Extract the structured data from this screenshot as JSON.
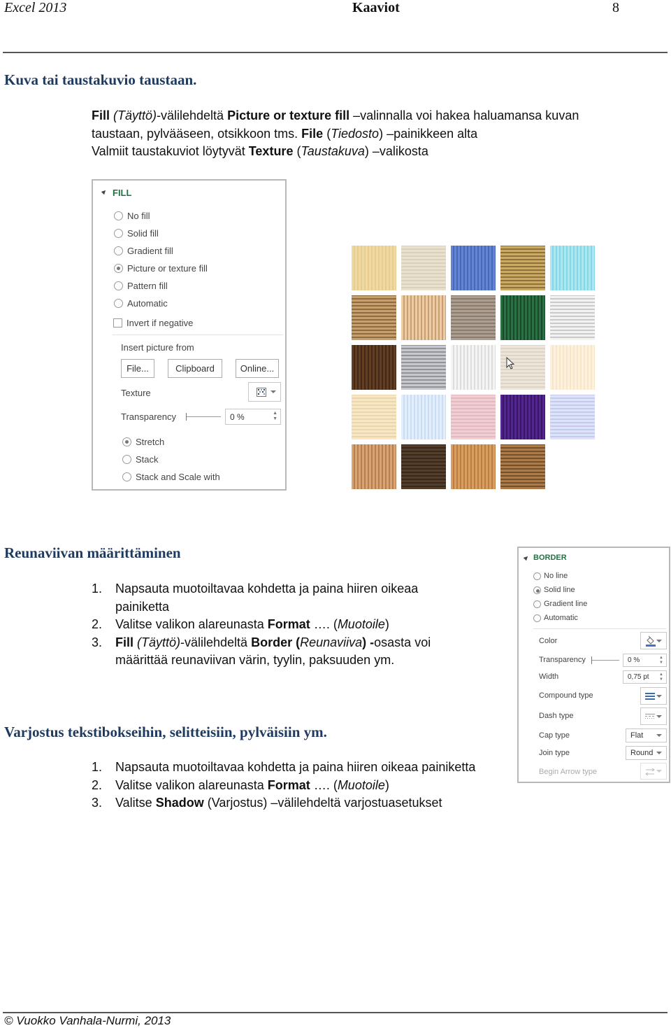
{
  "header": {
    "left": "Excel 2013",
    "center": "Kaaviot",
    "page_number": "8"
  },
  "section1": {
    "title": "Kuva tai taustakuvio taustaan.",
    "para_runs": [
      [
        {
          "t": "Fill",
          "b": true
        },
        {
          "t": " (Täyttö)",
          "i": true
        },
        {
          "t": "-välilehdeltä "
        },
        {
          "t": "Picture or texture fill",
          "b": true
        },
        {
          "t": "  –valinnalla voi hakea haluamansa kuvan"
        }
      ],
      [
        {
          "t": "taustaan,  pylvääseen, otsikkoon tms. "
        },
        {
          "t": "File",
          "b": true
        },
        {
          "t": " ("
        },
        {
          "t": "Tiedosto",
          "i": true
        },
        {
          "t": ")  –painikkeen alta"
        }
      ],
      [
        {
          "t": "Valmiit taustakuviot löytyvät "
        },
        {
          "t": "Texture",
          "b": true
        },
        {
          "t": " ("
        },
        {
          "t": "Taustakuva",
          "i": true
        },
        {
          "t": ") –valikosta"
        }
      ]
    ]
  },
  "fill_panel": {
    "title": "FILL",
    "options": [
      {
        "label": "No fill",
        "selected": false
      },
      {
        "label": "Solid fill",
        "selected": false
      },
      {
        "label": "Gradient fill",
        "selected": false
      },
      {
        "label": "Picture or texture fill",
        "selected": true
      },
      {
        "label": "Pattern fill",
        "selected": false
      },
      {
        "label": "Automatic",
        "selected": false
      }
    ],
    "invert_label": "Invert if negative",
    "invert_checked": false,
    "insert_from_label": "Insert picture from",
    "buttons": {
      "file": "File...",
      "clipboard": "Clipboard",
      "online": "Online..."
    },
    "texture_label": "Texture",
    "texture_icon": "texture-icon",
    "transparency_label": "Transparency",
    "transparency_value": "0 %",
    "transparency_percent": 0,
    "tiling": [
      {
        "label": "Stretch",
        "selected": true
      },
      {
        "label": "Stack",
        "selected": false
      },
      {
        "label": "Stack and Scale with",
        "selected": false
      }
    ]
  },
  "textures": [
    {
      "name": "papyrus",
      "colors": [
        "#f0d9a0",
        "#e6c98a"
      ]
    },
    {
      "name": "canvas",
      "colors": [
        "#e8e0cc",
        "#d8cfb8"
      ]
    },
    {
      "name": "denim",
      "colors": [
        "#5b7fd0",
        "#3f62b8"
      ]
    },
    {
      "name": "woven-mat",
      "colors": [
        "#c9a65c",
        "#8a6a32"
      ]
    },
    {
      "name": "water-droplets",
      "colors": [
        "#a8e6f0",
        "#7fd4e6"
      ]
    },
    {
      "name": "paper-bag",
      "colors": [
        "#c49a66",
        "#8a6438"
      ]
    },
    {
      "name": "fish-fossil",
      "colors": [
        "#edc9a0",
        "#c59a6b"
      ]
    },
    {
      "name": "sand",
      "colors": [
        "#a89a8c",
        "#857566"
      ]
    },
    {
      "name": "green-marble",
      "colors": [
        "#1f6b3a",
        "#0d3f20"
      ]
    },
    {
      "name": "white-marble",
      "colors": [
        "#f2f2f2",
        "#c8c8c8"
      ]
    },
    {
      "name": "brown-marble",
      "colors": [
        "#5a3418",
        "#3a1e0c"
      ]
    },
    {
      "name": "granite",
      "colors": [
        "#c4c6cc",
        "#8c8e94"
      ]
    },
    {
      "name": "newsprint",
      "colors": [
        "#f4f4f4",
        "#dcdcdc"
      ]
    },
    {
      "name": "recycled-paper",
      "colors": [
        "#ece4d8",
        "#dcd2c2"
      ]
    },
    {
      "name": "parchment",
      "colors": [
        "#fdf1dc",
        "#f6e6c8"
      ]
    },
    {
      "name": "stationery",
      "colors": [
        "#f6e6c4",
        "#ead4a8"
      ]
    },
    {
      "name": "blue-tissue-paper",
      "colors": [
        "#e2eefc",
        "#c8dcf4"
      ]
    },
    {
      "name": "pink-tissue-paper",
      "colors": [
        "#f0cdd2",
        "#e4b4bc"
      ]
    },
    {
      "name": "purple-mesh",
      "colors": [
        "#4a1a8a",
        "#2e0c5e"
      ]
    },
    {
      "name": "bouquet",
      "colors": [
        "#d8e4f8",
        "#c8c4ec"
      ]
    },
    {
      "name": "cork",
      "colors": [
        "#d8a06a",
        "#b07a48"
      ]
    },
    {
      "name": "walnut",
      "colors": [
        "#4a3420",
        "#2e1e10"
      ]
    },
    {
      "name": "oak",
      "colors": [
        "#d69a58",
        "#b87838"
      ]
    },
    {
      "name": "medium-wood",
      "colors": [
        "#a87440",
        "#6e4820"
      ]
    }
  ],
  "section2": {
    "title": "Reunaviivan määrittäminen",
    "items": [
      {
        "num": "1.",
        "runs": [
          {
            "t": "Napsauta muotoiltavaa kohdetta ja paina hiiren oikeaa painiketta"
          }
        ]
      },
      {
        "num": "2.",
        "runs": [
          {
            "t": "Valitse valikon alareunasta  "
          },
          {
            "t": "Format",
            "b": true
          },
          {
            "t": " …. ("
          },
          {
            "t": "Muotoile",
            "i": true
          },
          {
            "t": ")"
          }
        ]
      },
      {
        "num": "3.",
        "runs": [
          {
            "t": "Fill",
            "b": true
          },
          {
            "t": " (Täyttö)",
            "i": true
          },
          {
            "t": "-välilehdeltä "
          },
          {
            "t": "Border (",
            "b": true
          },
          {
            "t": "Reunaviiva",
            "i": true
          },
          {
            "t": ")",
            "b": true
          },
          {
            "t": " -",
            "b": true
          },
          {
            "t": "osasta  voi määrittää reunaviivan värin, tyylin, paksuuden ym."
          }
        ]
      }
    ]
  },
  "border_panel": {
    "title": "BORDER",
    "options": [
      {
        "label": "No line",
        "selected": false
      },
      {
        "label": "Solid line",
        "selected": true
      },
      {
        "label": "Gradient line",
        "selected": false
      },
      {
        "label": "Automatic",
        "selected": false
      }
    ],
    "color_label": "Color",
    "color_icon": "paint-bucket-icon",
    "color_value": "#4472c4",
    "transparency_label": "Transparency",
    "transparency_value": "0 %",
    "transparency_percent": 0,
    "width_label": "Width",
    "width_value": "0,75 pt",
    "compound_label": "Compound type",
    "dash_label": "Dash type",
    "cap_label": "Cap type",
    "cap_value": "Flat",
    "join_label": "Join type",
    "join_value": "Round",
    "begin_arrow_label": "Begin Arrow type"
  },
  "section3": {
    "title": "Varjostus tekstibokseihin, selitteisiin, pylväisiin ym.",
    "items": [
      {
        "num": "1.",
        "runs": [
          {
            "t": "Napsauta muotoiltavaa kohdetta ja paina hiiren oikeaa painiketta"
          }
        ]
      },
      {
        "num": "2.",
        "runs": [
          {
            "t": "Valitse valikon alareunasta  "
          },
          {
            "t": "Format",
            "b": true
          },
          {
            "t": " …. ("
          },
          {
            "t": "Muotoile",
            "i": true
          },
          {
            "t": ")"
          }
        ]
      },
      {
        "num": "3.",
        "runs": [
          {
            "t": "Valitse "
          },
          {
            "t": "Shadow",
            "b": true
          },
          {
            "t": "  (Varjostus) –välilehdeltä varjostuasetukset"
          }
        ]
      }
    ]
  },
  "footer": {
    "copyright": "© Vuokko Vanhala-Nurmi, 2013"
  },
  "colors": {
    "heading": "#1f3a5f",
    "panel_accent": "#217346",
    "panel_border": "#b8b8b8"
  }
}
